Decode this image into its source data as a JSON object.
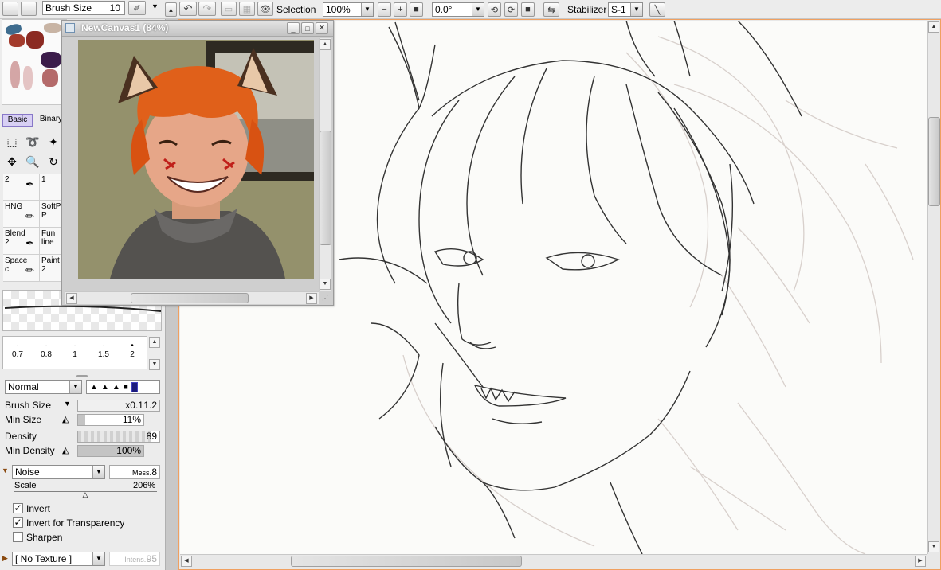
{
  "toolbar": {
    "brush_size_label": "Brush Size",
    "brush_size_value": "10",
    "selection_label": "Selection",
    "zoom_value": "100%",
    "rotation_value": "0.0°",
    "stabilizer_label": "Stabilizer",
    "stabilizer_value": "S-1"
  },
  "navigator": {
    "title": "NewCanvas1 (84%)"
  },
  "tool_tabs": [
    "Basic",
    "Binary"
  ],
  "brush_grid": [
    {
      "name": "2",
      "sub": ""
    },
    {
      "name": "1",
      "sub": ""
    },
    {
      "name": "HNG",
      "sub": ""
    },
    {
      "name": "SoftP",
      "sub": "P"
    },
    {
      "name": "Blend",
      "sub": "2"
    },
    {
      "name": "Fun",
      "sub": "line"
    },
    {
      "name": "Space",
      "sub": "c"
    },
    {
      "name": "Paint",
      "sub": "2"
    }
  ],
  "size_presets": [
    "0.7",
    "0.8",
    "1",
    "1.5",
    "2"
  ],
  "brush_settings": {
    "blend_mode": "Normal",
    "brush_size_label": "Brush Size",
    "brush_size_mult": "x0.1",
    "brush_size_value": "1.2",
    "min_size_label": "Min Size",
    "min_size_value": "11%",
    "density_label": "Density",
    "density_value": "89",
    "min_density_label": "Min Density",
    "min_density_value": "100%",
    "texture_name": "Noise",
    "mess_label": "Mess.",
    "mess_value": "8",
    "scale_label": "Scale",
    "scale_value": "206%",
    "invert_label": "Invert",
    "invert_transparency_label": "Invert for Transparency",
    "sharpen_label": "Sharpen",
    "no_texture_label": "[ No Texture ]",
    "intens_label": "Intens.",
    "intens_value": "95"
  },
  "levels": {
    "min_size_pct": 11,
    "density_pct": 89,
    "min_density_pct": 100,
    "scale_pct": 50,
    "canvas_vscroll_pct": 20,
    "canvas_hscroll_pct": 20
  }
}
